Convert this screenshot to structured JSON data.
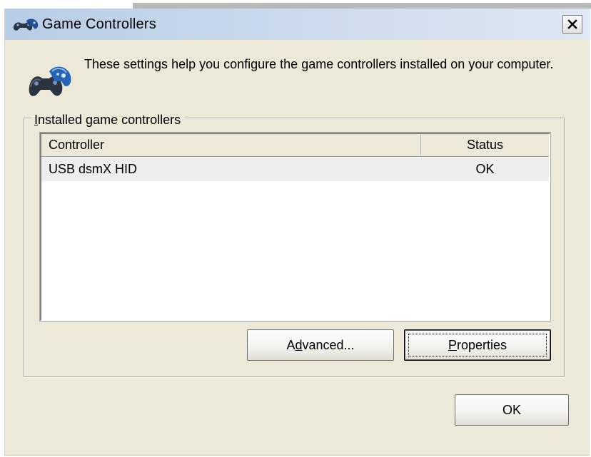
{
  "window": {
    "title": "Game Controllers",
    "close_symbol": "✕"
  },
  "intro": {
    "text": "These settings help you configure the game controllers installed on your computer."
  },
  "group": {
    "label_mnemonic": "I",
    "label_rest": "nstalled game controllers"
  },
  "table": {
    "columns": [
      "Controller",
      "Status"
    ],
    "rows": [
      {
        "controller": "USB dsmX HID",
        "status": "OK"
      }
    ]
  },
  "buttons": {
    "advanced": {
      "pre": "A",
      "mnemonic": "d",
      "post": "vanced..."
    },
    "properties": {
      "pre": "",
      "mnemonic": "P",
      "post": "roperties"
    },
    "ok": "OK"
  },
  "icons": {
    "title_icon": "gamepad-icon",
    "header_icon": "gamepad-icon",
    "close_icon": "close-icon"
  },
  "colors": {
    "titlebar_start": "#b8cde6",
    "dialog_bg": "#ece9d8",
    "row_bg": "#eeeeee"
  }
}
